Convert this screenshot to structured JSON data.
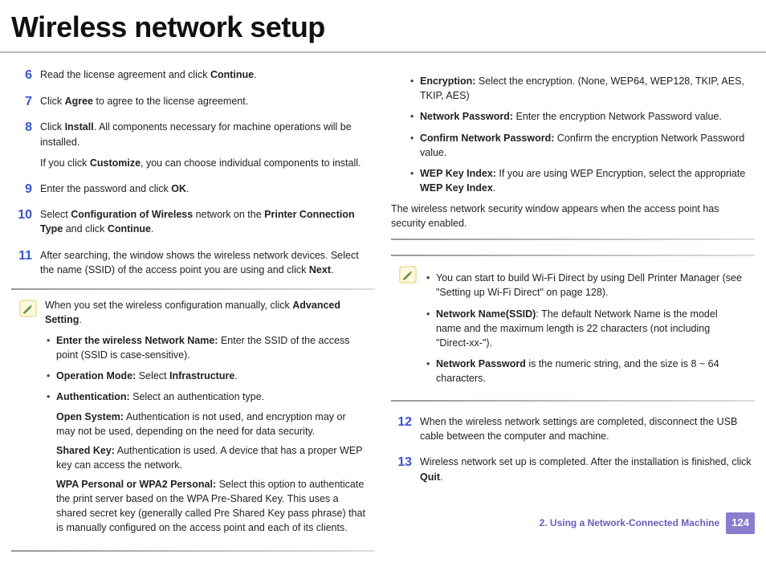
{
  "title": "Wireless network setup",
  "left": {
    "steps": [
      {
        "num": "6",
        "paras": [
          {
            "segments": [
              {
                "t": "Read the license agreement and click "
              },
              {
                "t": "Continue",
                "b": true
              },
              {
                "t": "."
              }
            ]
          }
        ]
      },
      {
        "num": "7",
        "paras": [
          {
            "segments": [
              {
                "t": "Click "
              },
              {
                "t": "Agree",
                "b": true
              },
              {
                "t": " to agree to the license agreement."
              }
            ]
          }
        ]
      },
      {
        "num": "8",
        "paras": [
          {
            "segments": [
              {
                "t": "Click "
              },
              {
                "t": "Install",
                "b": true
              },
              {
                "t": ". All components necessary for machine operations will be installed."
              }
            ]
          },
          {
            "segments": [
              {
                "t": "If you click "
              },
              {
                "t": "Customize",
                "b": true
              },
              {
                "t": ", you can choose individual components to install."
              }
            ]
          }
        ]
      },
      {
        "num": "9",
        "paras": [
          {
            "segments": [
              {
                "t": "Enter the password and click "
              },
              {
                "t": "OK",
                "b": true
              },
              {
                "t": "."
              }
            ]
          }
        ]
      },
      {
        "num": "10",
        "paras": [
          {
            "segments": [
              {
                "t": "Select "
              },
              {
                "t": "Configuration of Wireless",
                "b": true
              },
              {
                "t": " network on the "
              },
              {
                "t": "Printer Connection Type",
                "b": true
              },
              {
                "t": " and click "
              },
              {
                "t": "Continue",
                "b": true
              },
              {
                "t": "."
              }
            ]
          }
        ]
      },
      {
        "num": "11",
        "paras": [
          {
            "segments": [
              {
                "t": "After searching, the window shows the wireless network devices. Select the name (SSID) of the access point you are using and click "
              },
              {
                "t": "Next",
                "b": true
              },
              {
                "t": "."
              }
            ]
          }
        ]
      }
    ],
    "note": {
      "intro": {
        "segments": [
          {
            "t": "When you set the wireless configuration manually, click "
          },
          {
            "t": "Advanced Setting",
            "b": true
          },
          {
            "t": "."
          }
        ]
      },
      "bullets": [
        {
          "lead": {
            "segments": [
              {
                "t": "Enter the wireless Network Name:",
                "b": true
              },
              {
                "t": " Enter the SSID of the access point (SSID is case-sensitive)."
              }
            ]
          }
        },
        {
          "lead": {
            "segments": [
              {
                "t": "Operation Mode:",
                "b": true
              },
              {
                "t": " Select "
              },
              {
                "t": "Infrastructure",
                "b": true
              },
              {
                "t": "."
              }
            ]
          }
        },
        {
          "lead": {
            "segments": [
              {
                "t": "Authentication:",
                "b": true
              },
              {
                "t": " Select an authentication type."
              }
            ]
          },
          "sub": [
            {
              "segments": [
                {
                  "t": "Open System:",
                  "b": true
                },
                {
                  "t": " Authentication is not used, and encryption may or may not be used, depending on the need for data security."
                }
              ]
            },
            {
              "segments": [
                {
                  "t": "Shared Key:",
                  "b": true
                },
                {
                  "t": " Authentication is used. A device that has a proper WEP key can access the network."
                }
              ]
            },
            {
              "segments": [
                {
                  "t": "WPA Personal or WPA2 Personal:",
                  "b": true
                },
                {
                  "t": " Select this option to authenticate the print server based on the WPA Pre-Shared Key. This uses a shared secret key (generally called Pre Shared Key pass phrase) that is manually configured on the access point and each of its clients."
                }
              ]
            }
          ]
        }
      ]
    }
  },
  "right": {
    "top_bullets": [
      {
        "segments": [
          {
            "t": "Encryption:",
            "b": true
          },
          {
            "t": " Select the encryption. (None, WEP64, WEP128, TKIP, AES, TKIP, AES)"
          }
        ]
      },
      {
        "segments": [
          {
            "t": "Network Password:",
            "b": true
          },
          {
            "t": " Enter the encryption Network Password value."
          }
        ]
      },
      {
        "segments": [
          {
            "t": "Confirm Network Password:",
            "b": true
          },
          {
            "t": " Confirm the encryption Network Password value."
          }
        ]
      },
      {
        "segments": [
          {
            "t": "WEP Key Index:",
            "b": true
          },
          {
            "t": " If you are using WEP Encryption, select the appropriate "
          },
          {
            "t": "WEP Key Index",
            "b": true
          },
          {
            "t": "."
          }
        ]
      }
    ],
    "top_para": "The wireless network security window appears when the access point has security enabled.",
    "note2": {
      "bullets": [
        {
          "segments": [
            {
              "t": "You can start to build Wi-Fi Direct by using Dell Printer Manager (see \"Setting up Wi-Fi Direct\" on page 128)."
            }
          ]
        },
        {
          "segments": [
            {
              "t": "Network Name(SSID)",
              "b": true
            },
            {
              "t": ": The default Network Name is the model name and the maximum length is 22 characters (not including \"Direct-xx-\")."
            }
          ]
        },
        {
          "segments": [
            {
              "t": "Network Password",
              "b": true
            },
            {
              "t": " is the numeric string, and the size is 8 ~ 64 characters."
            }
          ]
        }
      ]
    },
    "steps": [
      {
        "num": "12",
        "paras": [
          {
            "segments": [
              {
                "t": "When the wireless network settings are completed, disconnect the USB cable between the computer and machine."
              }
            ]
          }
        ]
      },
      {
        "num": "13",
        "paras": [
          {
            "segments": [
              {
                "t": "Wireless network set up is completed. After the installation is finished, click "
              },
              {
                "t": "Quit",
                "b": true
              },
              {
                "t": "."
              }
            ]
          }
        ]
      }
    ]
  },
  "footer": {
    "chapter": "2.  Using a Network-Connected Machine",
    "page": "124"
  }
}
